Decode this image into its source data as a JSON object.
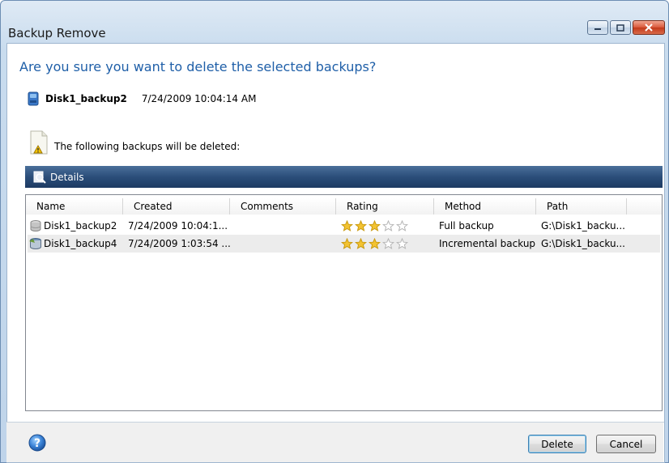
{
  "window": {
    "title": "Backup Remove",
    "caption_buttons": [
      "minimize",
      "maximize",
      "close"
    ]
  },
  "dialog": {
    "question": "Are you sure you want to delete the selected backups?",
    "backup_name": "Disk1_backup2",
    "backup_date": "7/24/2009 10:04:14 AM",
    "notice": "The following backups will be deleted:",
    "details_label": "Details"
  },
  "table": {
    "columns": [
      "Name",
      "Created",
      "Comments",
      "Rating",
      "Method",
      "Path"
    ],
    "rows": [
      {
        "name": "Disk1_backup2",
        "created": "7/24/2009 10:04:1...",
        "comments": "",
        "rating_filled": 3,
        "rating_total": 5,
        "method": "Full backup",
        "path": "G:\\Disk1_backu...",
        "icon": "disk-icon"
      },
      {
        "name": "Disk1_backup4",
        "created": "7/24/2009 1:03:54 ...",
        "comments": "",
        "rating_filled": 3,
        "rating_total": 5,
        "method": "Incremental backup",
        "path": "G:\\Disk1_backu...",
        "icon": "incremental-disk-icon"
      }
    ]
  },
  "buttons": {
    "delete": "Delete",
    "cancel": "Cancel",
    "help_icon": "help-icon"
  },
  "colors": {
    "headline": "#1f5fa8",
    "details_bar": "#2b4e7a",
    "star_filled": "#f3c331",
    "close_button": "#c2391a"
  }
}
